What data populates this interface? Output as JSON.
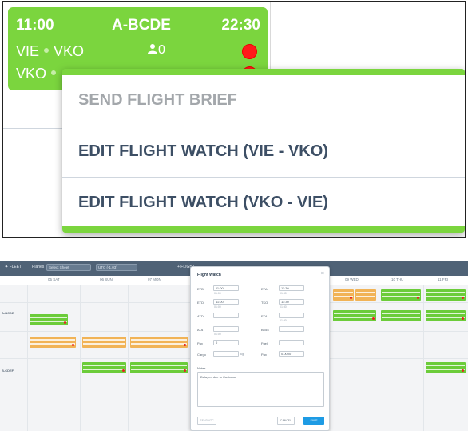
{
  "top": {
    "flight_card": {
      "start_time": "11:00",
      "registration": "A-BCDE",
      "end_time": "22:30",
      "legs": [
        {
          "from": "VIE",
          "to": "VKO",
          "pax": "0",
          "status_color": "#ff1a1a"
        },
        {
          "from": "VKO",
          "to": "",
          "pax": "",
          "status_color": "#ff1a1a"
        }
      ],
      "card_color": "#7bd53e"
    },
    "context_menu": {
      "items": [
        {
          "label": "SEND FLIGHT BRIEF",
          "enabled": false
        },
        {
          "label": "EDIT FLIGHT WATCH (VIE - VKO)",
          "enabled": true
        },
        {
          "label": "EDIT FLIGHT WATCH (VKO - VIE)",
          "enabled": true
        }
      ],
      "accent_color": "#7bd53e"
    }
  },
  "bottom": {
    "header": {
      "fleet_label": "✈ FLEET",
      "view_label": "Planes",
      "view_value": "Select Sheet",
      "date_value": "UTC (-1.03)",
      "add_label": "+ FLIGHT"
    },
    "days": [
      "05 SAT",
      "06 SUN",
      "07 MON",
      "08 TUE",
      "09 WED",
      "10 THU",
      "11 FRI"
    ],
    "row_labels": [
      "",
      "A-BCDE",
      "",
      "",
      "B-CDEF",
      ""
    ],
    "dialog": {
      "title": "Flight Watch",
      "fields_left": [
        {
          "label": "ETD",
          "value": "11:00",
          "sub": "01:00"
        },
        {
          "label": "ETD",
          "value": "11:00",
          "sub": "01:00"
        },
        {
          "label": "ATD",
          "value": ""
        },
        {
          "label": "ATA",
          "value": "",
          "sub": "01:00"
        },
        {
          "label": "Pax",
          "value": "0"
        },
        {
          "label": "Cargo",
          "value": "",
          "unit": "kg"
        }
      ],
      "fields_right": [
        {
          "label": "ETA",
          "value": "11:30",
          "sub": "01:30"
        },
        {
          "label": "TKO",
          "value": "11:30",
          "sub": "01:30"
        },
        {
          "label": "ETA",
          "value": "",
          "sub": "01:30"
        },
        {
          "label": "Block",
          "value": ""
        },
        {
          "label": "Fuel",
          "value": ""
        },
        {
          "label": "Pax",
          "value": "0.0000"
        }
      ],
      "notes_label": "Notes",
      "notes_value": "Delayed due to Customs",
      "buttons": {
        "update": "SEND ATC",
        "cancel": "CANCEL",
        "save": "SAVE"
      }
    }
  }
}
